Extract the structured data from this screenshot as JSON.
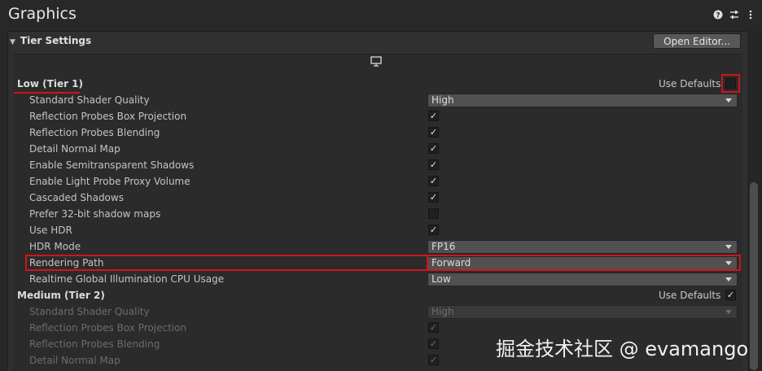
{
  "window": {
    "title": "Graphics"
  },
  "header_icons": [
    "help-icon",
    "settings-sliders-icon",
    "more-menu-icon"
  ],
  "section": {
    "title": "Tier Settings",
    "button_label": "Open Editor..."
  },
  "tiers": [
    {
      "label": "Low (Tier 1)",
      "use_defaults_label": "Use Defaults",
      "use_defaults_checked": false,
      "rows": [
        {
          "label": "Standard Shader Quality",
          "type": "dropdown",
          "value": "High"
        },
        {
          "label": "Reflection Probes Box Projection",
          "type": "checkbox",
          "checked": true
        },
        {
          "label": "Reflection Probes Blending",
          "type": "checkbox",
          "checked": true
        },
        {
          "label": "Detail Normal Map",
          "type": "checkbox",
          "checked": true
        },
        {
          "label": "Enable Semitransparent Shadows",
          "type": "checkbox",
          "checked": true
        },
        {
          "label": "Enable Light Probe Proxy Volume",
          "type": "checkbox",
          "checked": true
        },
        {
          "label": "Cascaded Shadows",
          "type": "checkbox",
          "checked": true
        },
        {
          "label": "Prefer 32-bit shadow maps",
          "type": "checkbox",
          "checked": false
        },
        {
          "label": "Use HDR",
          "type": "checkbox",
          "checked": true
        },
        {
          "label": "HDR Mode",
          "type": "dropdown",
          "value": "FP16"
        },
        {
          "label": "Rendering Path",
          "type": "dropdown",
          "value": "Forward"
        },
        {
          "label": "Realtime Global Illumination CPU Usage",
          "type": "dropdown",
          "value": "Low"
        }
      ]
    },
    {
      "label": "Medium (Tier 2)",
      "use_defaults_label": "Use Defaults",
      "use_defaults_checked": true,
      "rows": [
        {
          "label": "Standard Shader Quality",
          "type": "dropdown",
          "value": "High"
        },
        {
          "label": "Reflection Probes Box Projection",
          "type": "checkbox",
          "checked": true
        },
        {
          "label": "Reflection Probes Blending",
          "type": "checkbox",
          "checked": true
        },
        {
          "label": "Detail Normal Map",
          "type": "checkbox",
          "checked": true
        }
      ]
    }
  ],
  "watermark": "掘金技术社区 @ evamango",
  "colors": {
    "highlight_red": "#d0141c",
    "background": "#282828"
  }
}
